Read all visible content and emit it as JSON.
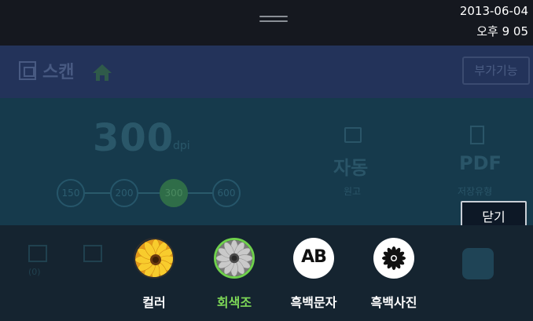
{
  "status_bar": {
    "date": "2013-06-04",
    "time": "오후 9  05"
  },
  "header": {
    "title": "스캔",
    "more_button": "부가기능"
  },
  "settings": {
    "resolution": {
      "value": "300",
      "unit": "dpi",
      "options": [
        "150",
        "200",
        "300",
        "600"
      ],
      "selected": "300"
    },
    "original": {
      "value": "자동",
      "label": "원고"
    },
    "file_format": {
      "value": "PDF",
      "label": "저장유형"
    }
  },
  "close_button": "닫기",
  "background_items": {
    "mail_count": "(0)"
  },
  "color_mode": {
    "selected": "회색조",
    "options": [
      {
        "label": "컬러",
        "icon": "color-flower-icon"
      },
      {
        "label": "회색조",
        "icon": "grayscale-flower-icon"
      },
      {
        "label": "흑백문자",
        "icon": "ab-text-icon",
        "icon_text": "AB"
      },
      {
        "label": "흑백사진",
        "icon": "bw-flower-icon"
      }
    ]
  },
  "colors": {
    "accent_green": "#7ed957",
    "panel_bg": "#163a4c",
    "header_bg": "#23335a"
  }
}
